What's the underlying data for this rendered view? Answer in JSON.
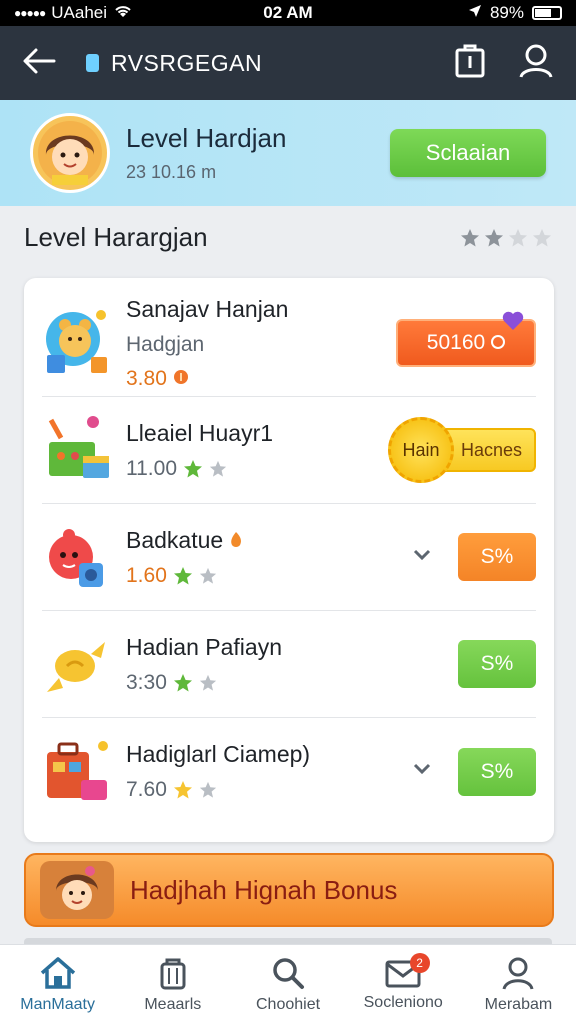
{
  "status_bar": {
    "carrier": "UAahei",
    "time": "02 AM",
    "battery": "89%"
  },
  "header": {
    "title": "RVSRGEGAN"
  },
  "user": {
    "name": "Level Hardjan",
    "subtitle": "23 10.16 m",
    "button": "Sclaaian"
  },
  "section": {
    "title": "Level Harargjan",
    "rating": 2,
    "max_rating": 4
  },
  "items": [
    {
      "name": "Sanajav Hanjan",
      "sub": "Hadgjan",
      "price": "3.80",
      "button": "50160"
    },
    {
      "name": "Lleaiel Huayr1",
      "price": "11.00",
      "stars": 1,
      "badge": "Hain",
      "button": "Hacnes"
    },
    {
      "name": "Badkatue",
      "price": "1.60",
      "stars": 1,
      "button": "S%"
    },
    {
      "name": "Hadian Pafiayn",
      "price": "3:30",
      "stars": 1,
      "button": "S%"
    },
    {
      "name": "Hadiglarl Ciamep)",
      "price": "7.60",
      "stars": 1,
      "button": "S%"
    }
  ],
  "bonus": {
    "label": "Hadjhah Hignah Bonus"
  },
  "nav": [
    {
      "label": "ManMaaty",
      "icon": "home-icon"
    },
    {
      "label": "Meaarls",
      "icon": "bag-icon"
    },
    {
      "label": "Choohiet",
      "icon": "search-icon"
    },
    {
      "label": "Socleniono",
      "icon": "mail-icon",
      "badge": "2"
    },
    {
      "label": "Merabam",
      "icon": "person-icon"
    }
  ],
  "colors": {
    "header": "#2c343f",
    "banner": "#aee3f6",
    "green": "#65c23d",
    "orange": "#f48427",
    "red": "#f05a1e",
    "yellow": "#f7c923"
  }
}
